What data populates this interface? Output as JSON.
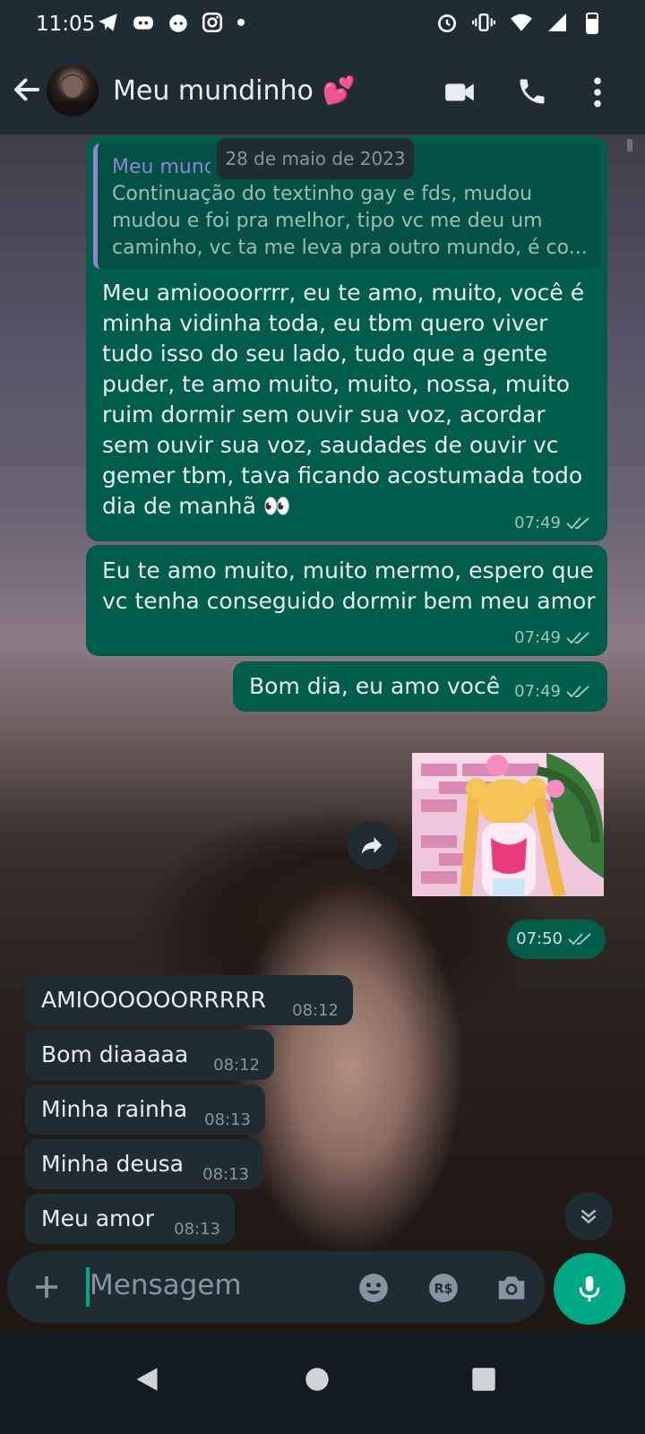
{
  "status_bar": {
    "time": "11:05"
  },
  "header": {
    "back_icon": "arrow-left-icon",
    "contact_name": "Meu mundinho 💕"
  },
  "date_chip": "28 de maio de 2023",
  "messages": [
    {
      "direction": "out",
      "quoted": {
        "sender": "Meu mundinho",
        "text": "Continuação do textinho gay e fds, mudou mudou e foi pra melhor, tipo vc me deu um caminho, vc ta me leva pra outro mundo, é co..."
      },
      "text": "Meu amioooorrrr, eu te amo, muito, você é minha vidinha toda, eu tbm quero viver tudo isso do seu lado, tudo que a gente puder, te amo muito, muito, nossa, muito ruim dormir sem ouvir sua voz, acordar sem ouvir sua voz, saudades de ouvir vc gemer tbm, tava ficando acostumada todo dia de manhã 👀",
      "time": "07:49"
    },
    {
      "direction": "out",
      "text": "Eu te amo muito, muito mermo, espero que vc tenha conseguido dormir bem meu amor",
      "time": "07:49"
    },
    {
      "direction": "out",
      "text": "Bom dia, eu amo você",
      "time": "07:49"
    },
    {
      "direction": "out",
      "type": "image",
      "time": "07:50"
    },
    {
      "direction": "in",
      "text": "AMIOOOOOORRRRR",
      "time": "08:12"
    },
    {
      "direction": "in",
      "text": "Bom diaaaaa",
      "time": "08:12"
    },
    {
      "direction": "in",
      "text": "Minha rainha",
      "time": "08:13"
    },
    {
      "direction": "in",
      "text": "Minha deusa",
      "time": "08:13"
    },
    {
      "direction": "in",
      "text": "Meu amor",
      "time": "08:13"
    }
  ],
  "composer": {
    "placeholder": "Mensagem"
  },
  "colors": {
    "outgoing_bubble": "#005c4b",
    "incoming_bubble": "#1f2c34",
    "accent": "#00a884"
  }
}
